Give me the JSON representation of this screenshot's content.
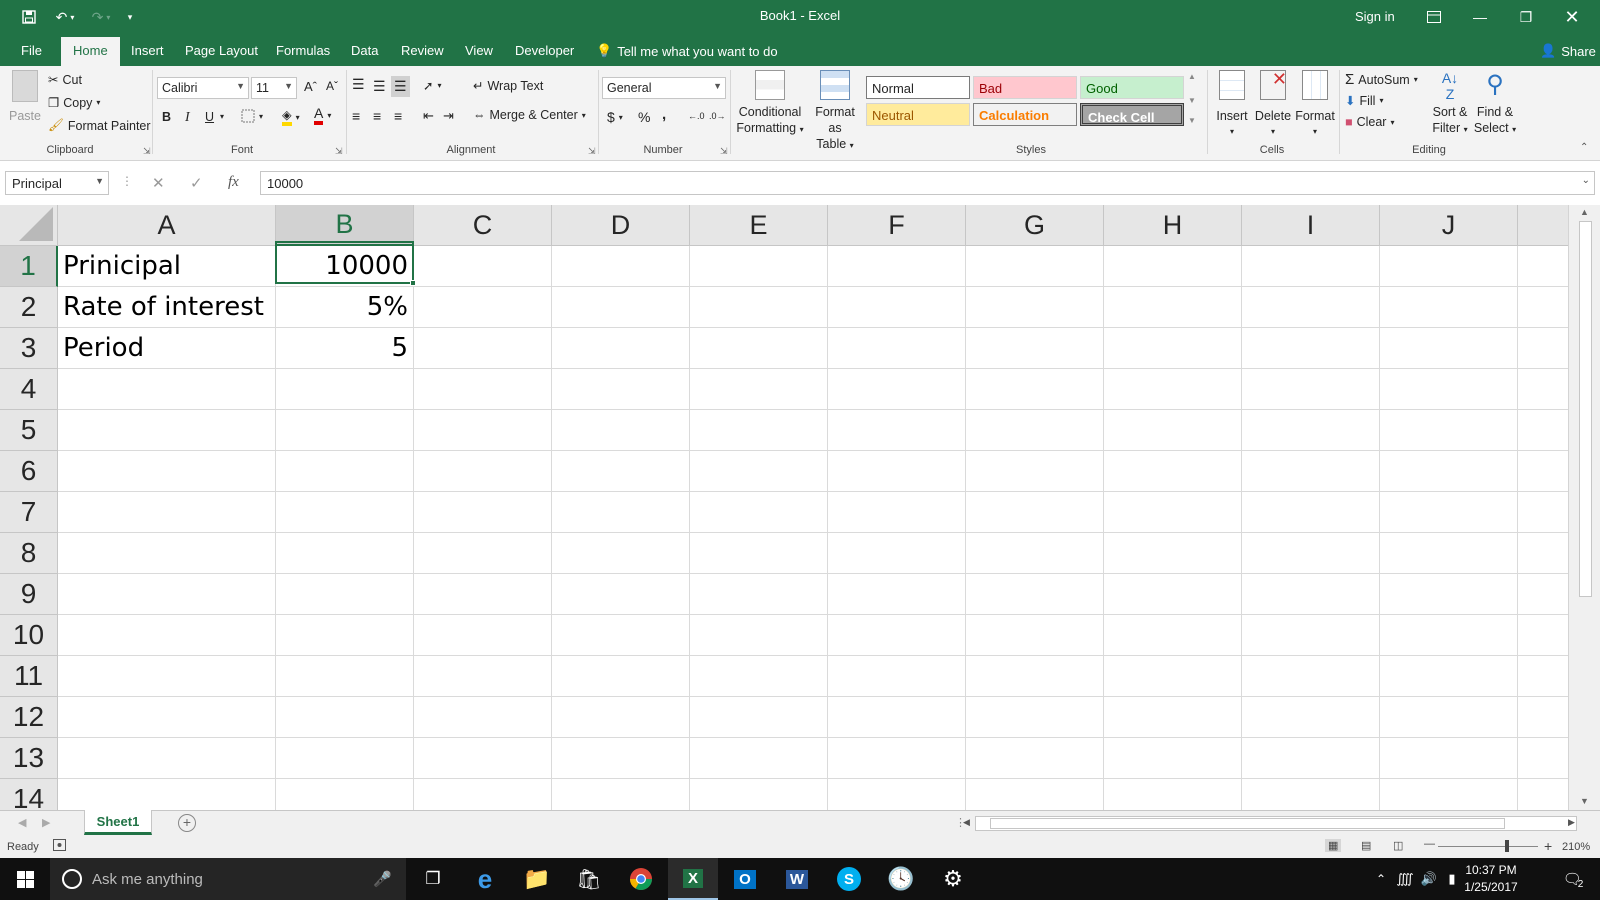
{
  "window": {
    "title": "Book1  -  Excel",
    "sign_in": "Sign in",
    "share": "Share"
  },
  "tabs": [
    "File",
    "Home",
    "Insert",
    "Page Layout",
    "Formulas",
    "Data",
    "Review",
    "View",
    "Developer"
  ],
  "tell_me": "Tell me what you want to do",
  "ribbon": {
    "clipboard": {
      "paste": "Paste",
      "cut": "Cut",
      "copy": "Copy",
      "format_painter": "Format Painter",
      "label": "Clipboard"
    },
    "font": {
      "name": "Calibri",
      "size": "11",
      "bold": "B",
      "italic": "I",
      "underline": "U",
      "label": "Font"
    },
    "alignment": {
      "wrap_text": "Wrap Text",
      "merge_center": "Merge & Center",
      "label": "Alignment"
    },
    "number": {
      "format": "General",
      "currency": "$",
      "percent": "%",
      "comma": ",",
      "label": "Number"
    },
    "styles": {
      "conditional_1": "Conditional",
      "conditional_2": "Formatting",
      "format_table_1": "Format as",
      "format_table_2": "Table",
      "normal": "Normal",
      "bad": "Bad",
      "good": "Good",
      "neutral": "Neutral",
      "calculation": "Calculation",
      "check_cell": "Check Cell",
      "label": "Styles"
    },
    "cells": {
      "insert": "Insert",
      "delete": "Delete",
      "format": "Format",
      "label": "Cells"
    },
    "editing": {
      "autosum": "AutoSum",
      "fill": "Fill",
      "clear": "Clear",
      "sort_1": "Sort &",
      "sort_2": "Filter",
      "find_1": "Find &",
      "find_2": "Select",
      "label": "Editing"
    }
  },
  "formula_bar": {
    "name_box": "Principal",
    "fx": "fx",
    "value": "10000"
  },
  "columns": [
    "A",
    "B",
    "C",
    "D",
    "E",
    "F",
    "G",
    "H",
    "I",
    "J"
  ],
  "rows": [
    "1",
    "2",
    "3",
    "4",
    "5",
    "6",
    "7",
    "8",
    "9",
    "10",
    "11",
    "12",
    "13",
    "14"
  ],
  "cells": {
    "A1": "Prinicipal",
    "B1": "10000",
    "A2": "Rate of interest",
    "B2": "5%",
    "A3": "Period",
    "B3": "5"
  },
  "sheet_tab": "Sheet1",
  "status": {
    "ready": "Ready",
    "zoom": "210%"
  },
  "taskbar": {
    "search": "Ask me anything",
    "time": "10:37 PM",
    "date": "1/25/2017",
    "notifications": "2"
  },
  "colors": {
    "accent": "#217346"
  }
}
